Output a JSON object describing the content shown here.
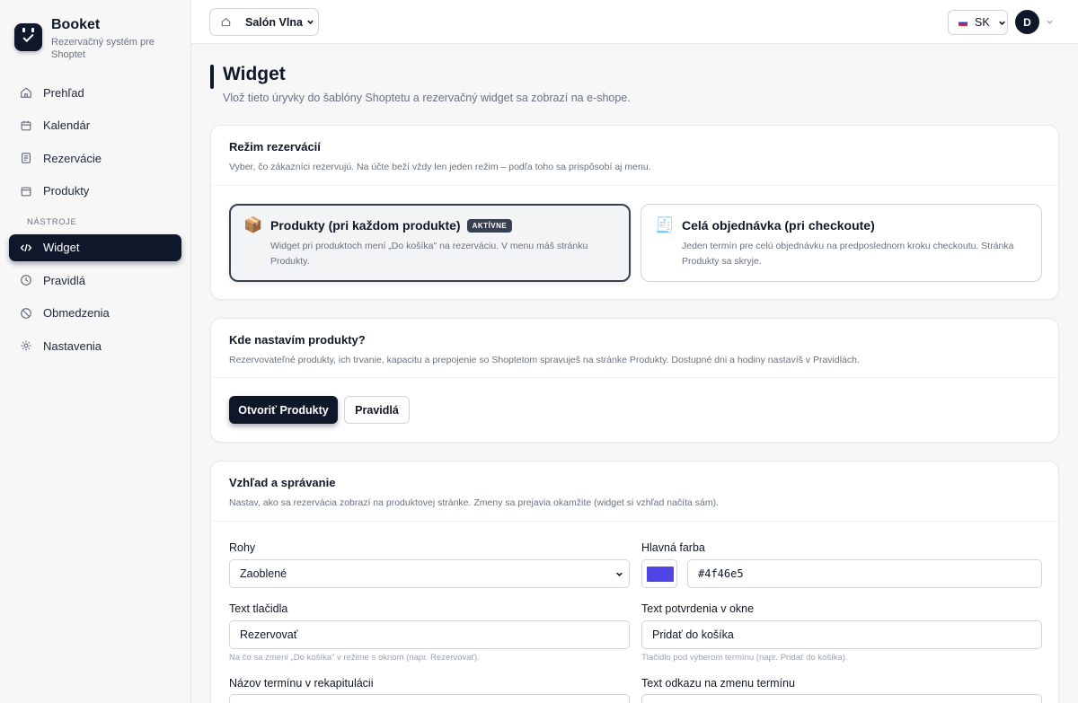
{
  "brand": {
    "name": "Booket",
    "subtitle": "Rezervačný systém pre Shoptet"
  },
  "nav": {
    "items": [
      {
        "label": "Prehľad",
        "icon": "home-icon"
      },
      {
        "label": "Kalendár",
        "icon": "calendar-icon"
      },
      {
        "label": "Rezervácie",
        "icon": "document-icon"
      },
      {
        "label": "Produkty",
        "icon": "box-icon"
      }
    ],
    "section_label": "NÁSTROJE",
    "tools": [
      {
        "label": "Widget",
        "icon": "code-icon",
        "active": true
      },
      {
        "label": "Pravidlá",
        "icon": "clock-icon"
      },
      {
        "label": "Obmedzenia",
        "icon": "ban-icon"
      },
      {
        "label": "Nastavenia",
        "icon": "gear-icon"
      }
    ]
  },
  "topbar": {
    "shop": "Salón Vlna",
    "language": "SK",
    "avatar_initial": "D"
  },
  "page": {
    "title": "Widget",
    "description": "Vlož tieto úryvky do šablóny Shoptetu a rezervačný widget sa zobrazí na e-shope."
  },
  "mode_card": {
    "title": "Režim rezervácií",
    "description": "Vyber, čo zákazníci rezervujú. Na účte beží vždy len jeden režim – podľa toho sa prispôsobí aj menu.",
    "options": [
      {
        "icon": "📦",
        "title": "Produkty (pri každom produkte)",
        "badge": "AKTÍVNE",
        "description": "Widget pri produktoch mení „Do košíka\" na rezerváciu. V menu máš stránku Produkty.",
        "active": true
      },
      {
        "icon": "🧾",
        "title": "Celá objednávka (pri checkoute)",
        "description": "Jeden termín pre celú objednávku na predposlednom kroku checkoutu. Stránka Produkty sa skryje.",
        "active": false
      }
    ]
  },
  "products_card": {
    "title": "Kde nastavím produkty?",
    "description": "Rezervovateľné produkty, ich trvanie, kapacitu a prepojenie so Shoptetom spravuješ na stránke Produkty. Dostupné dni a hodiny nastavíš v Pravidlách.",
    "open_button": "Otvoriť Produkty",
    "rules_button": "Pravidlá"
  },
  "appearance_card": {
    "title": "Vzhľad a správanie",
    "description": "Nastav, ako sa rezervácia zobrazí na produktovej stránke. Zmeny sa prejavia okamžite (widget si vzhľad načíta sám).",
    "corners_label": "Rohy",
    "corners_value": "Zaoblené",
    "color_label": "Hlavná farba",
    "color_value": "#4f46e5",
    "button_text_label": "Text tlačidla",
    "button_text_value": "Rezervovať",
    "button_text_hint": "Na čo sa zmení „Do košíka\" v režime s oknom (napr. Rezervovať).",
    "confirm_text_label": "Text potvrdenia v okne",
    "confirm_text_value": "Pridať do košíka",
    "confirm_text_hint": "Tlačidlo pod výberom termínu (napr. Pridať do košíka).",
    "term_name_label": "Názov termínu v rekapitulácii",
    "change_link_label": "Text odkazu na zmenu termínu"
  },
  "colors": {
    "accent": "#0f172a",
    "swatch": "#4f46e5"
  }
}
